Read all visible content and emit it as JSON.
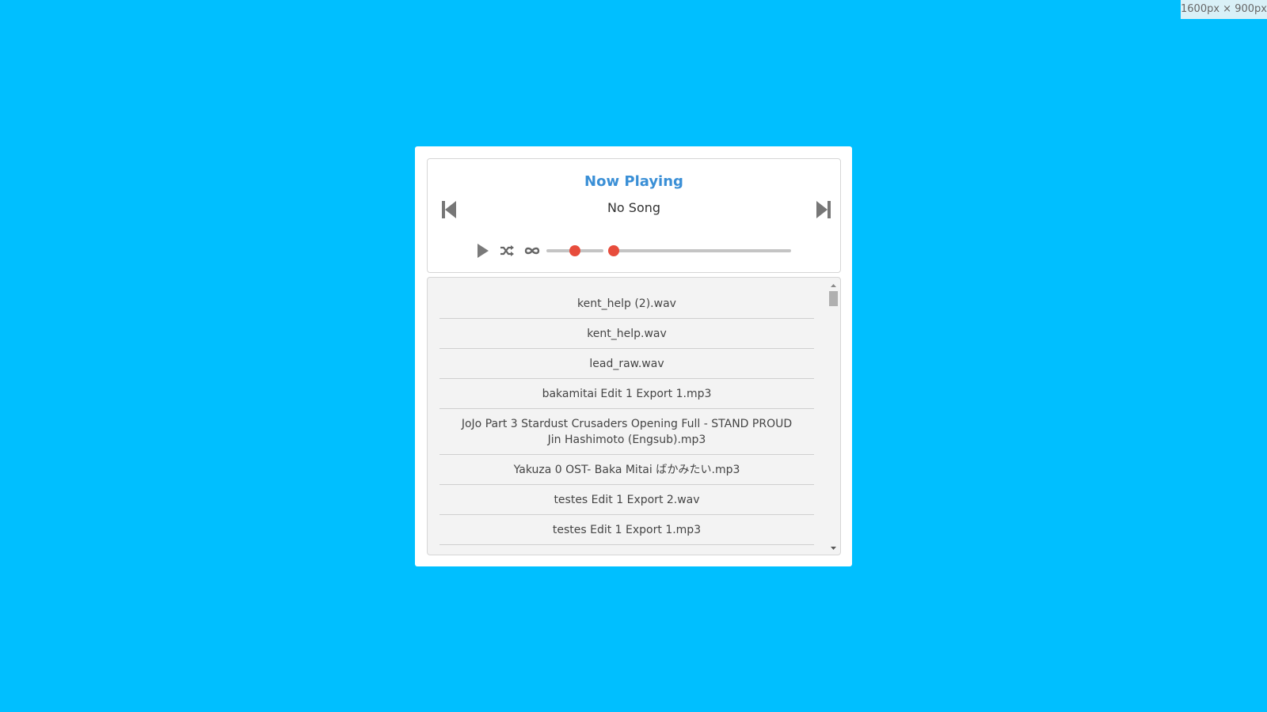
{
  "viewport_badge": "1600px × 900px",
  "player": {
    "title": "Now Playing",
    "current_song": "No Song",
    "volume_level": 0.5,
    "seek_position": 0,
    "accent_color": "#e74c3c",
    "title_color": "#3a8fd6",
    "background_color": "#00bfff",
    "icons": {
      "previous": "skip-back-icon",
      "next": "skip-forward-icon",
      "play": "play-icon",
      "shuffle": "shuffle-icon",
      "loop": "infinity-icon"
    }
  },
  "playlist": {
    "tracks": [
      "kent_help (2).wav",
      "kent_help.wav",
      "lead_raw.wav",
      "bakamitai Edit 1 Export 1.mp3",
      "JoJo Part 3 Stardust Crusaders Opening Full - STAND PROUD Jin Hashimoto (Engsub).mp3",
      "Yakuza 0 OST- Baka Mitai ばかみたい.mp3",
      "testes Edit 1 Export 2.wav",
      "testes Edit 1 Export 1.mp3"
    ]
  }
}
